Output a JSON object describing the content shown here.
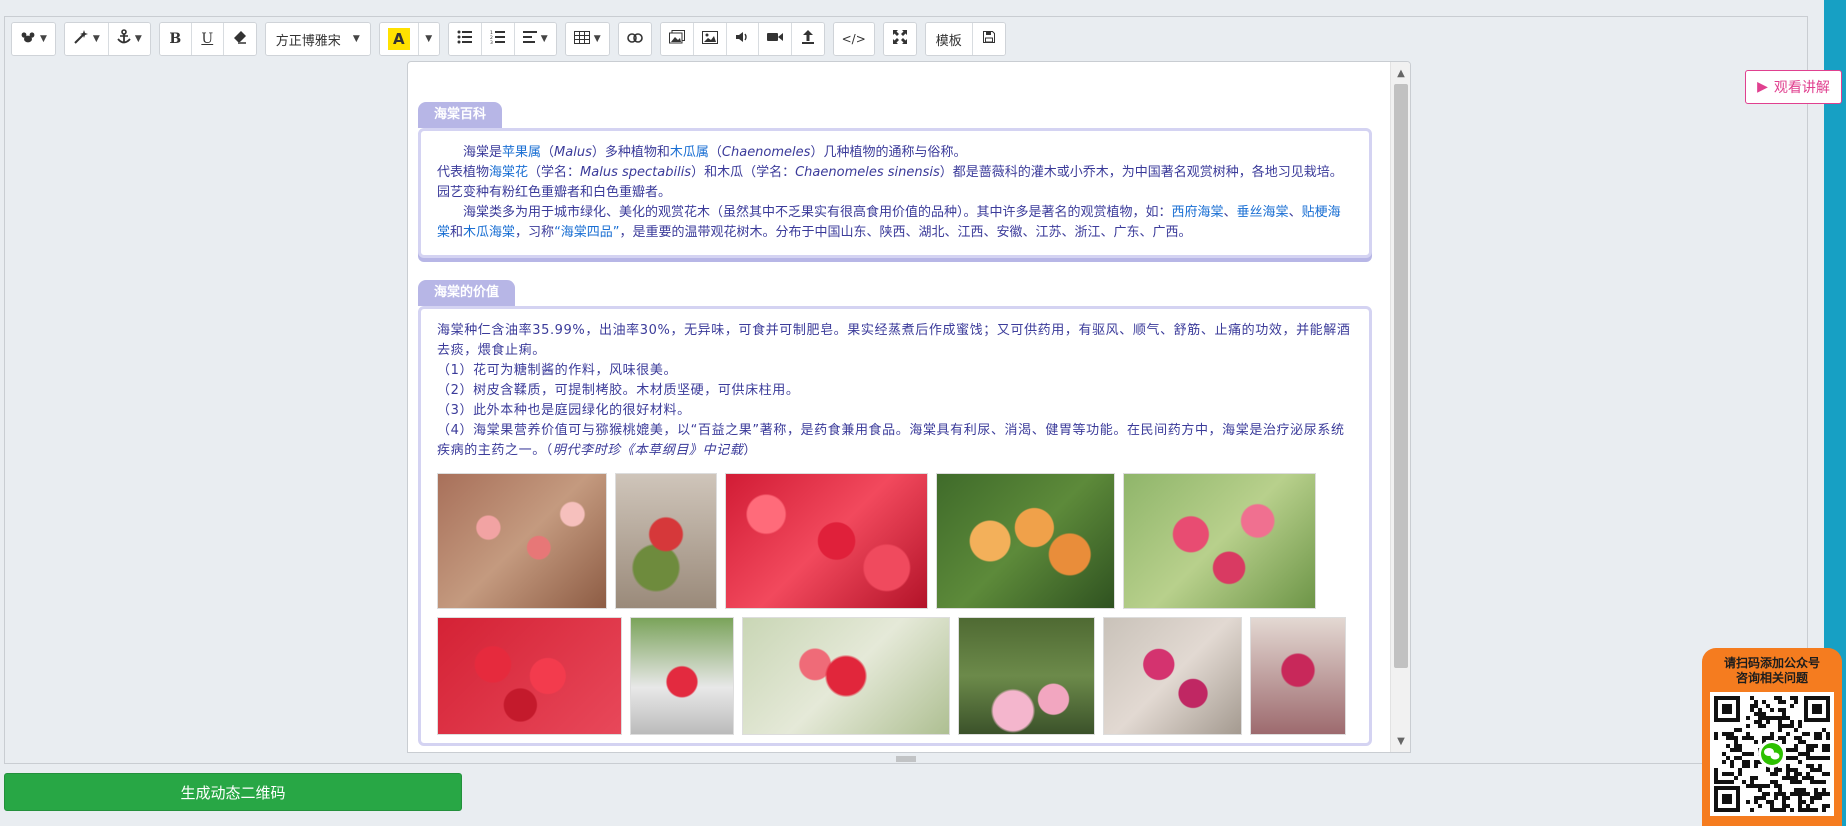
{
  "toolbar": {
    "font_family": "方正博雅宋",
    "highlight_letter": "A",
    "template_label": "模板",
    "bold_label": "B",
    "underline_label": "U",
    "code_label": "</>"
  },
  "section1": {
    "title": "海棠百科",
    "p1_a": "海棠是",
    "p1_link1": "苹果属",
    "p1_b": "（",
    "p1_latin1": "Malus",
    "p1_c": "）多种植物和",
    "p1_link2": "木瓜属",
    "p1_d": "（",
    "p1_latin2": "Chaenomeles",
    "p1_e": "）几种植物的通称与俗称。",
    "p2_a": "代表植物",
    "p2_link1": "海棠花",
    "p2_b": "（学名：",
    "p2_latin1": "Malus spectabilis",
    "p2_c": "）和木瓜（学名：",
    "p2_latin2": "Chaenomeles sinensis",
    "p2_d": "）都是蔷薇科的灌木或小乔木，为中国著名观赏树种，各地习见栽培。园艺变种有粉红色重瓣者和白色重瓣者。",
    "p3_a": "海棠类多为用于城市绿化、美化的观赏花木（虽然其中不乏果实有很高食用价值的品种）。其中许多是著名的观赏植物，如：",
    "p3_link1": "西府海棠",
    "p3_sep1": "、",
    "p3_link2": "垂丝海棠",
    "p3_sep2": "、",
    "p3_link3": "贴梗海棠",
    "p3_and": "和",
    "p3_link4": "木瓜海棠",
    "p3_b": "，习称",
    "p3_link5": "“海棠四品”",
    "p3_c": "，是重要的温带观花树木。分布于中国山东、陕西、湖北、江西、安徽、江苏、浙江、广东、广西。"
  },
  "section2": {
    "title": "海棠的价值",
    "l1": "海棠种仁含油率35.99%，出油率30%，无异味，可食并可制肥皂。果实经蒸煮后作成蜜饯；又可供药用，有驱风、顺气、舒筋、止痛的功效，并能解酒去痰，煨食止痢。",
    "l2": "（1）花可为糖制酱的作料，风味很美。",
    "l3": "（2）树皮含鞣质，可提制栲胶。木材质坚硬，可供床柱用。",
    "l4": "（3）此外本种也是庭园绿化的很好材料。",
    "l5": "（4）海棠果营养价值可与猕猴桃媲美，以“百益之果”著称，是药食兼用食品。海棠具有利尿、消渴、健胃等功能。在民间药方中，海棠是治疗泌尿系统疾病的主药之一。（",
    "cite_a": "明代",
    "cite_link1": "李时珍",
    "cite_link2": "《本草纲目》",
    "cite_b": "中记载",
    "l5_end": "）"
  },
  "actions": {
    "generate_label": "生成动态二维码",
    "watch_label": "观看讲解"
  },
  "qr": {
    "caption_line1": "请扫码添加公众号",
    "caption_line2": "咨询相关问题"
  },
  "colors": {
    "section_tab": "#b7b6e6",
    "section_border": "#d4d3f2",
    "text": "#3b3b9a",
    "link": "#1a6fd3",
    "generate_button": "#28a745",
    "watch_button": "#e0408f",
    "qr_card": "#f57c1f",
    "right_strip": "#17a0c4"
  }
}
